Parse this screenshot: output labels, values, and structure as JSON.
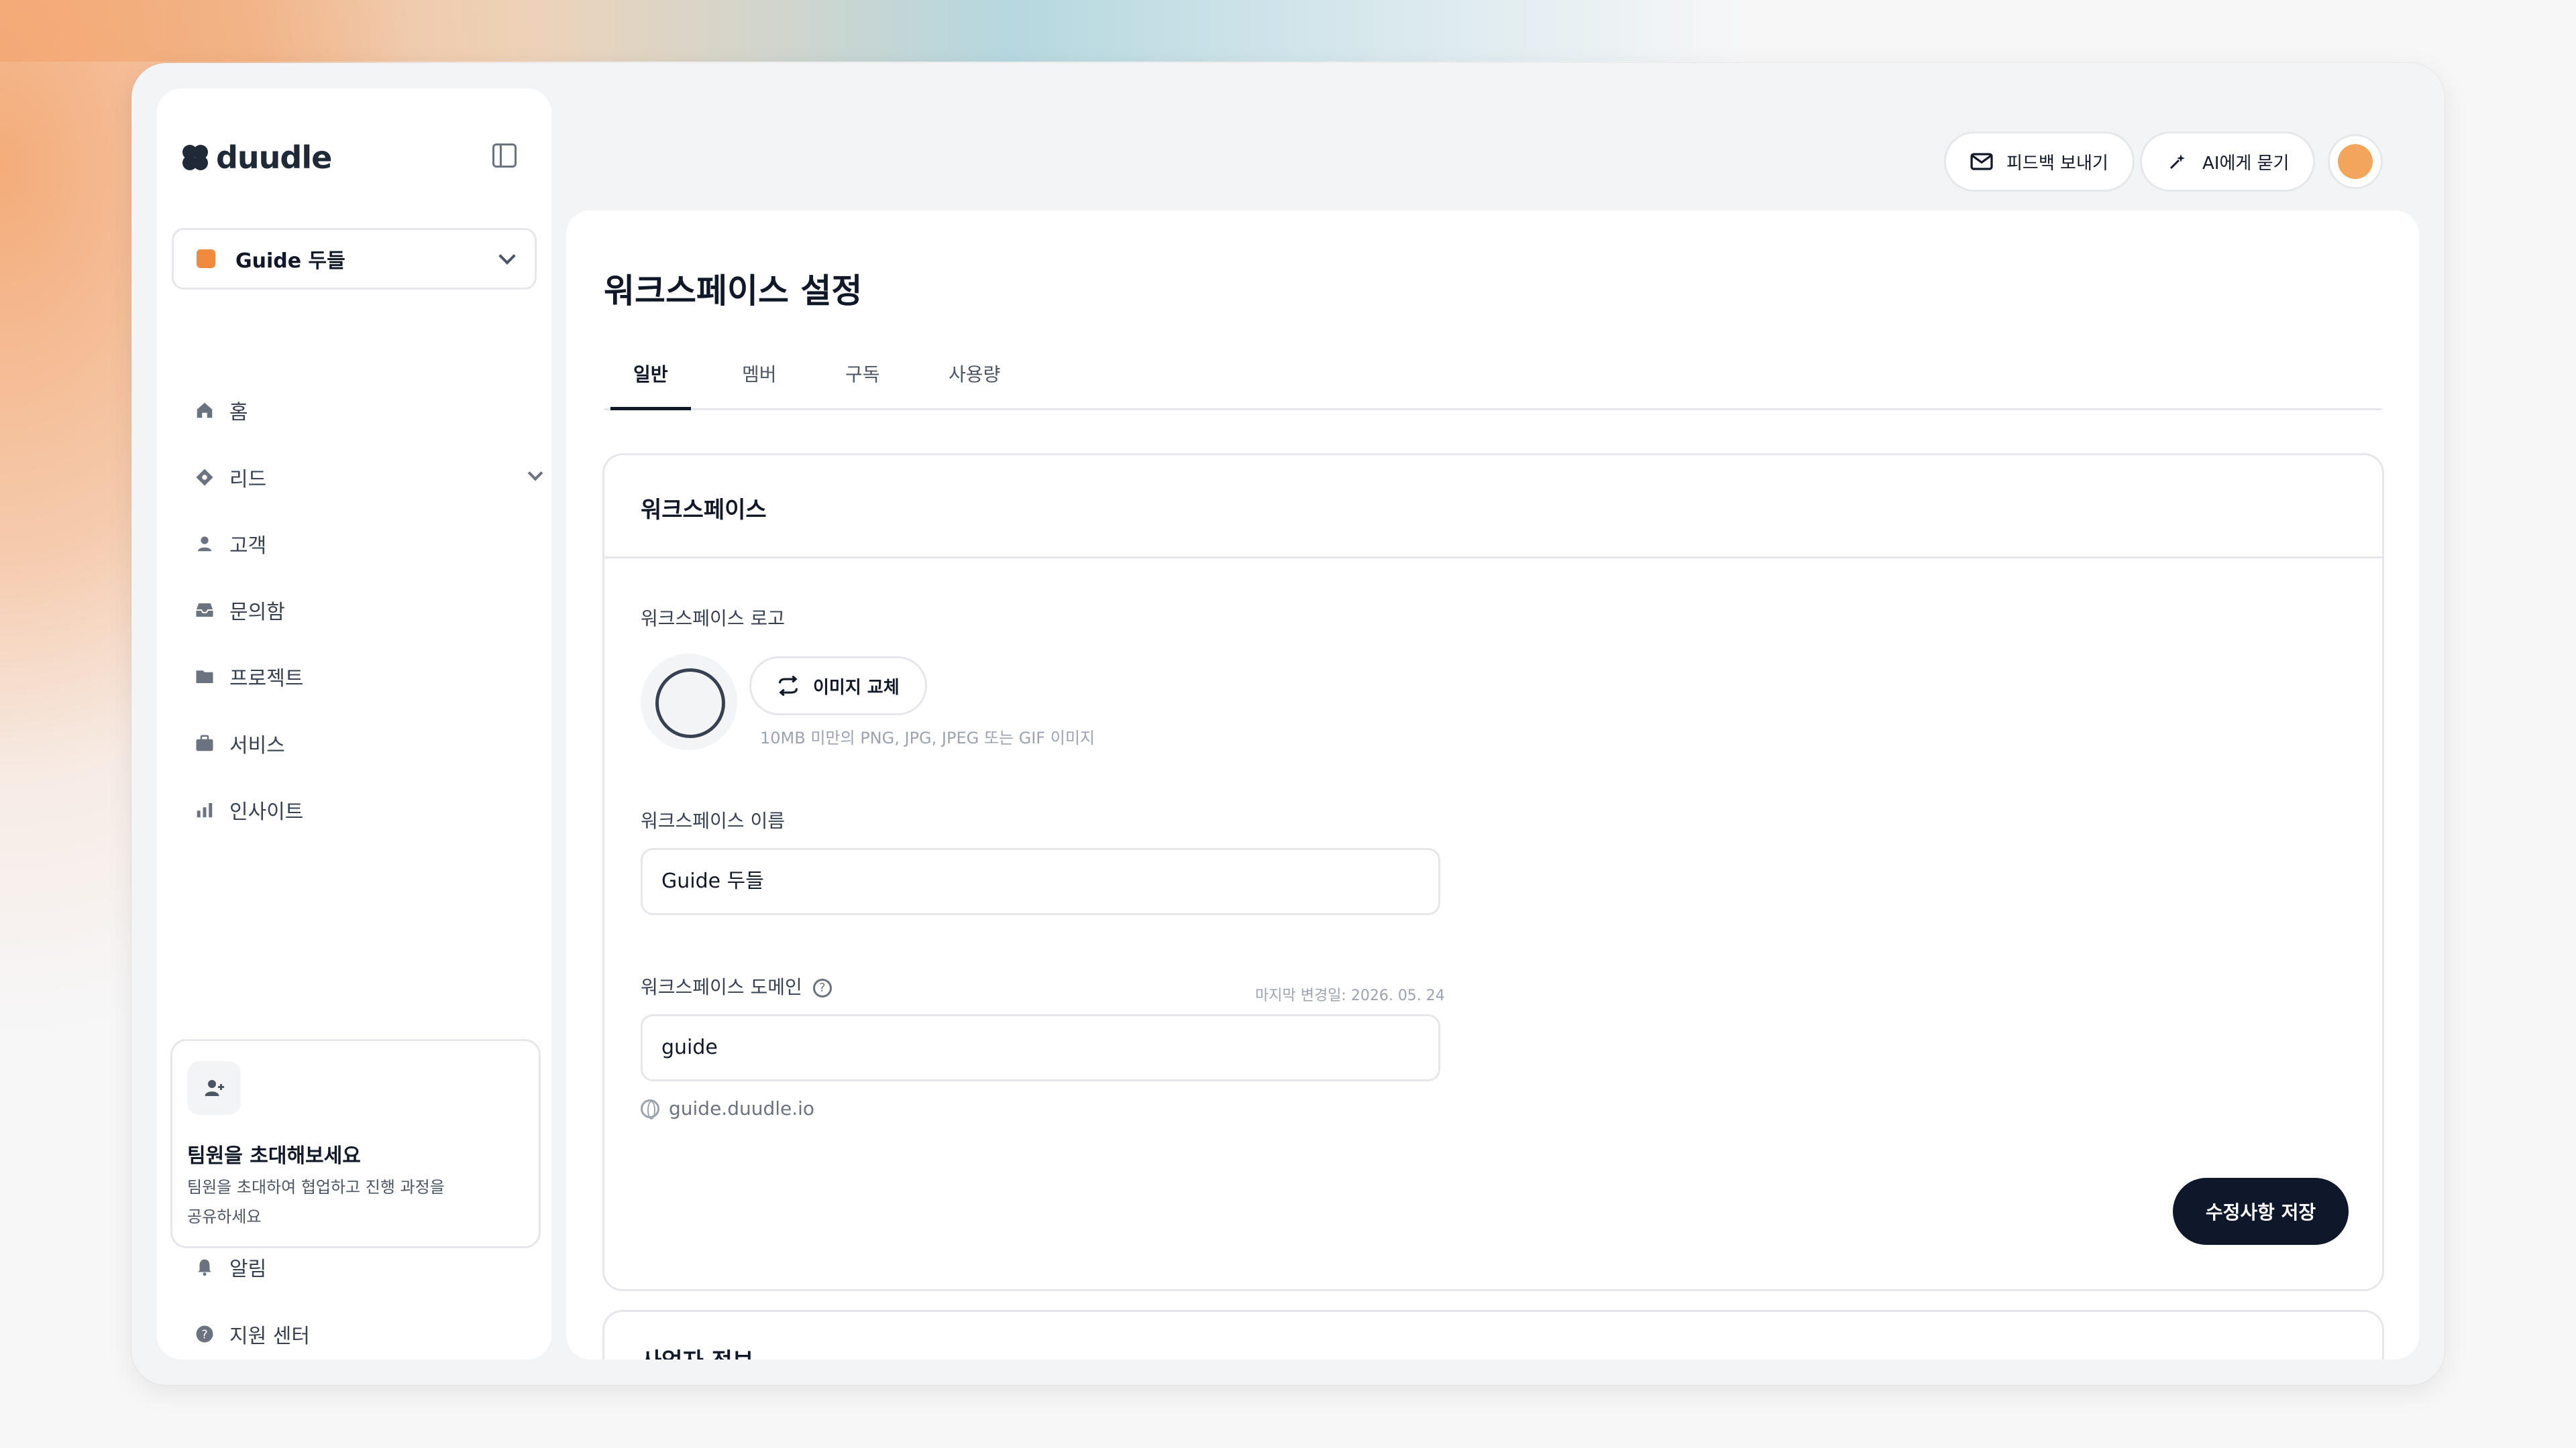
{
  "app": {
    "name": "duudle"
  },
  "workspace_switcher": {
    "name": "Guide 두들"
  },
  "nav": {
    "home": "홈",
    "leads": "리드",
    "customers": "고객",
    "inbox": "문의함",
    "projects": "프로젝트",
    "services": "서비스",
    "insights": "인사이트"
  },
  "invite": {
    "title": "팀원을 초대해보세요",
    "desc_line1": "팀원을 초대하여 협업하고 진행 과정을",
    "desc_line2": "공유하세요"
  },
  "bottom_nav": {
    "notifications": "알림",
    "support": "지원 센터"
  },
  "topbar": {
    "feedback": "피드백 보내기",
    "ask_ai": "AI에게 묻기"
  },
  "page": {
    "title": "워크스페이스 설정",
    "tabs": [
      "일반",
      "멤버",
      "구독",
      "사용량"
    ]
  },
  "card": {
    "title": "워크스페이스",
    "logo_label": "워크스페이스 로고",
    "replace_image": "이미지 교체",
    "logo_hint": "10MB 미만의 PNG, JPG, JPEG 또는 GIF 이미지",
    "name_label": "워크스페이스 이름",
    "name_value": "Guide 두들",
    "domain_label": "워크스페이스 도메인",
    "last_changed": "마지막 변경일: 2026. 05. 24",
    "domain_value": "guide",
    "domain_url": "guide.duudle.io",
    "save": "수정사항 저장"
  },
  "business_card": {
    "title": "사업자 정보"
  },
  "colors": {
    "accent": "#f08a3e",
    "primary": "#0f172a"
  }
}
